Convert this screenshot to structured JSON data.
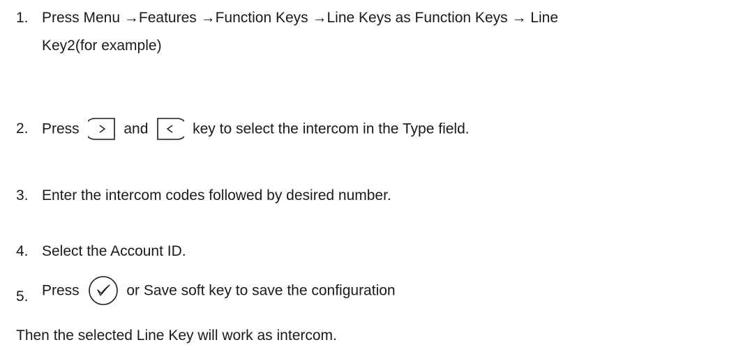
{
  "steps": [
    {
      "number": "1.",
      "line1": "Press Menu →Features →Function Keys →Line Keys as Function Keys → Line",
      "line2": "Key2(for example)"
    },
    {
      "number": "2.",
      "before": "Press",
      "middle": "and",
      "after": "key to select the intercom in the Type field.",
      "icons": [
        "right-arrow-key-icon",
        "left-arrow-key-icon"
      ]
    },
    {
      "number": "3.",
      "text": "Enter the intercom codes followed by desired number."
    },
    {
      "number": "4.",
      "text": "Select the Account ID."
    },
    {
      "number": "5.",
      "before": "Press",
      "after": "or Save soft key to save the configuration",
      "icons": [
        "ok-check-key-icon"
      ]
    }
  ],
  "footer": "Then the selected Line Key will work as intercom."
}
